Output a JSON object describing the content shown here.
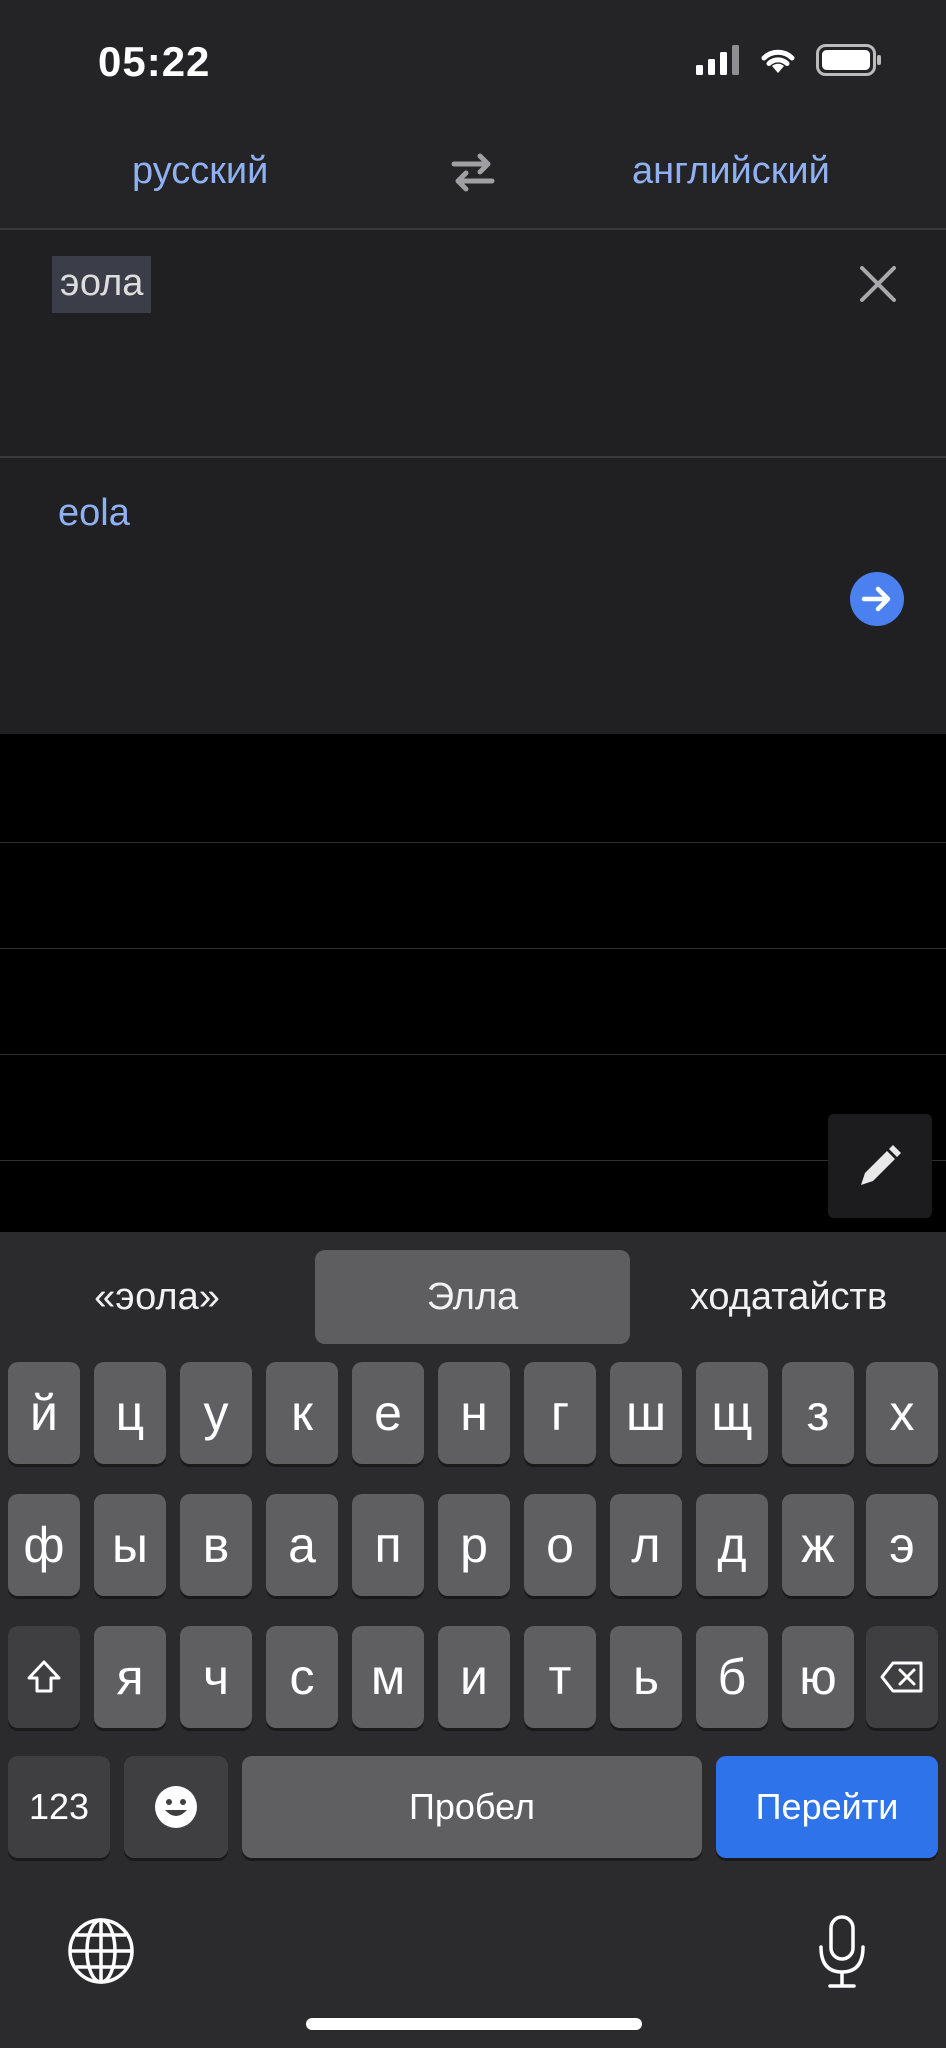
{
  "status": {
    "time": "05:22"
  },
  "languages": {
    "source": "русский",
    "target": "английский"
  },
  "input": {
    "text": "эола"
  },
  "output": {
    "text": "eola"
  },
  "suggestions": [
    "«эола»",
    "Элла",
    "ходатайств"
  ],
  "keyboard": {
    "row1": [
      "й",
      "ц",
      "у",
      "к",
      "е",
      "н",
      "г",
      "ш",
      "щ",
      "з",
      "х"
    ],
    "row2": [
      "ф",
      "ы",
      "в",
      "а",
      "п",
      "р",
      "о",
      "л",
      "д",
      "ж",
      "э"
    ],
    "row3": [
      "я",
      "ч",
      "с",
      "м",
      "и",
      "т",
      "ь",
      "б",
      "ю"
    ],
    "numbers_label": "123",
    "space_label": "Пробел",
    "go_label": "Перейти"
  },
  "colors": {
    "accent": "#8fb1f2",
    "go_key": "#2f73ea",
    "arrow_button": "#4a80ef"
  }
}
